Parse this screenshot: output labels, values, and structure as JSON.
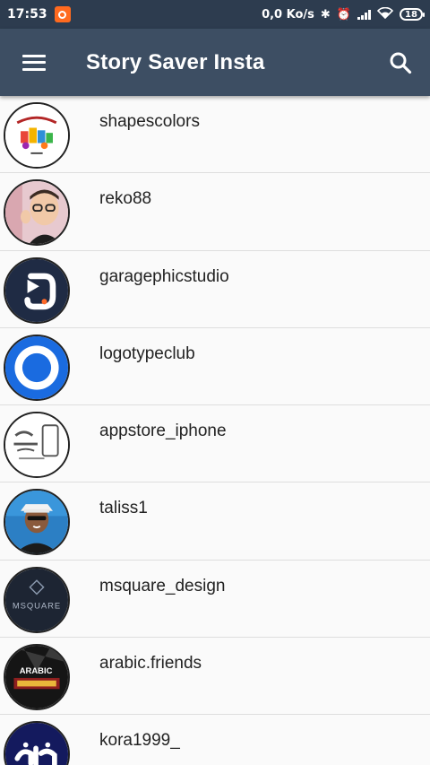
{
  "status_bar": {
    "time": "17:53",
    "speed": "0,0 Ko/s",
    "battery": "18",
    "icons": [
      "notification-icon",
      "bluetooth-icon",
      "alarm-off-icon",
      "signal-icon",
      "wifi-icon",
      "battery-icon"
    ]
  },
  "app_bar": {
    "title": "Story Saver Insta",
    "menu_icon": "hamburger-menu-icon",
    "search_icon": "search-icon",
    "color": "#3d4e63"
  },
  "accounts": [
    {
      "username": "shapescolors"
    },
    {
      "username": "reko88"
    },
    {
      "username": "garagephicstudio"
    },
    {
      "username": "logotypeclub"
    },
    {
      "username": "appstore_iphone"
    },
    {
      "username": "taliss1"
    },
    {
      "username": "msquare_design",
      "avatar_text": "MSQUARE"
    },
    {
      "username": "arabic.friends",
      "avatar_text": "ARABIC"
    },
    {
      "username": "kora1999_"
    }
  ]
}
